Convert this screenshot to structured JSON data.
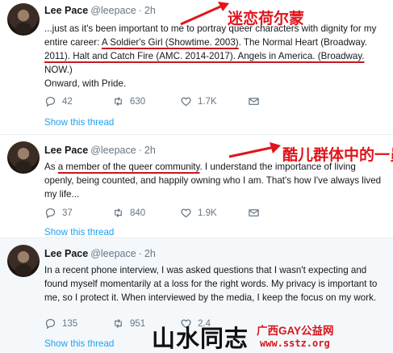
{
  "tweets": [
    {
      "name": "Lee Pace",
      "handle": "@leepace",
      "sep": "·",
      "time": "2h",
      "lines": [
        [
          "...just as it's been important to me to portray queer characters with dignity for my",
          "",
          ""
        ],
        [
          "entire career: ",
          "A Soldier's Girl (Showtime. 2003)",
          ". The Normal Heart (Broadway."
        ],
        [
          "2011). Halt and Catch Fire (AMC. 2014-2017). Angels in America. (Broadway.",
          "",
          ""
        ],
        [
          "NOW.)",
          "",
          ""
        ],
        [
          "Onward, with Pride.",
          "",
          ""
        ]
      ],
      "counts": {
        "reply": "42",
        "retweet": "630",
        "like": "1.7K"
      },
      "thread": "Show this thread"
    },
    {
      "name": "Lee Pace",
      "handle": "@leepace",
      "sep": "·",
      "time": "2h",
      "lines": [
        [
          "As ",
          "a member of the queer community",
          ". I understand the importance of living"
        ],
        [
          "openly, being counted, and happily owning who I am. That's how I've always lived",
          "",
          ""
        ],
        [
          "my life...",
          "",
          ""
        ]
      ],
      "counts": {
        "reply": "37",
        "retweet": "840",
        "like": "1.9K"
      },
      "thread": "Show this thread"
    },
    {
      "name": "Lee Pace",
      "handle": "@leepace",
      "sep": "·",
      "time": "2h",
      "lines": [
        [
          "In a recent phone interview, I was asked questions that I wasn't expecting and",
          "",
          ""
        ],
        [
          "found myself momentarily at a loss for the right words. My privacy is important to",
          "",
          ""
        ],
        [
          "me, so I protect it. When interviewed by the media, I keep the focus on my work.",
          "",
          ""
        ]
      ],
      "counts": {
        "reply": "135",
        "retweet": "951",
        "like": "2.4"
      },
      "thread": "Show this thread"
    }
  ],
  "annotations": {
    "first": "迷恋荷尔蒙",
    "second": "酷儿群体中的一员",
    "color": "#e0141c"
  },
  "watermark": {
    "big": "山水同志",
    "site": "广西GAY公益网",
    "url": "www.sstz.org"
  },
  "icons": [
    "reply-icon",
    "retweet-icon",
    "like-icon",
    "dm-icon"
  ]
}
